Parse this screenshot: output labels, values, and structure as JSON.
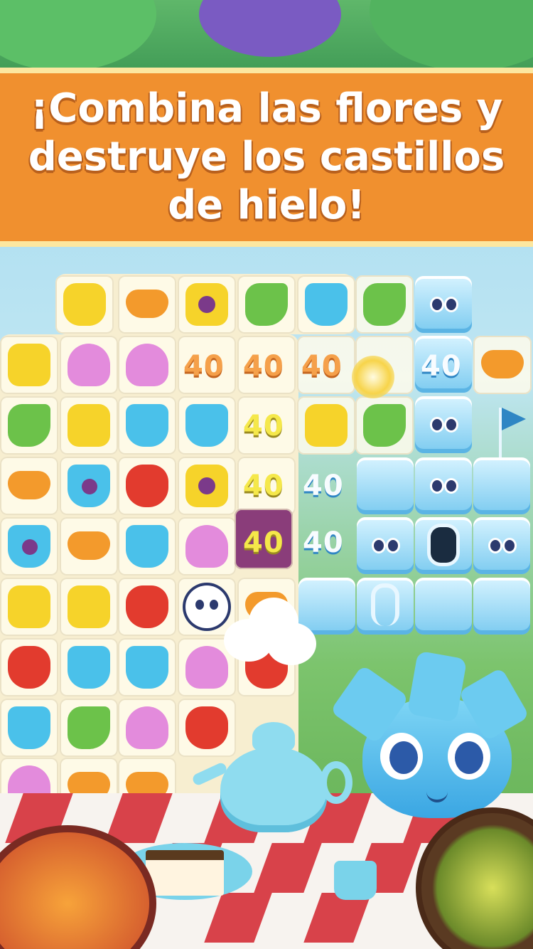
{
  "banner": {
    "line1": "¡Combina las flores y",
    "line2": "destruye los castillos",
    "line3": "de hielo!"
  },
  "scores": {
    "row1": [
      "40",
      "40",
      "40",
      "40"
    ],
    "row2": "40",
    "row3_yellow": "40",
    "row3_ice": "40",
    "row4_purple": "40",
    "row4_ice": "40"
  },
  "colors": {
    "banner": "#f0902f",
    "banner_border": "#fce7a0",
    "ice": "#7ccbf0",
    "yellow_flower": "#f6d32a",
    "pink_flower": "#e38bdc",
    "blue_flower": "#4ac1ea",
    "orange_flower": "#f39a2c",
    "red_flower": "#e23b2e",
    "green_flower": "#6cc24a"
  },
  "icons": [
    "yellow-rose-icon",
    "orange-lily-icon",
    "green-bell-icon",
    "blue-tulip-icon",
    "pink-bud-icon",
    "red-tulip-icon",
    "ice-block-icon",
    "owl-creature-icon",
    "blue-star-mascot-icon",
    "teapot-icon",
    "goal-flag-icon"
  ]
}
